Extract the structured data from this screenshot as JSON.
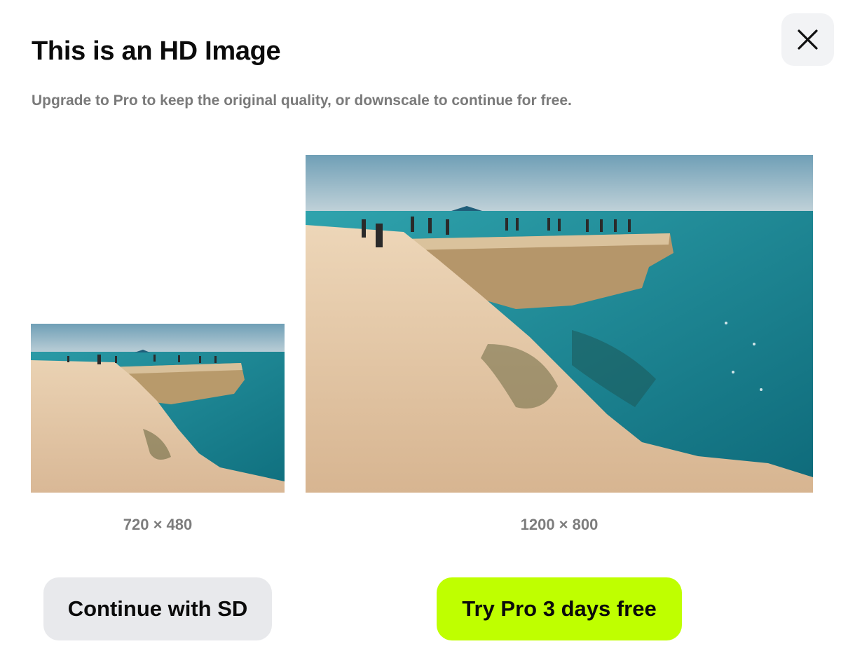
{
  "dialog": {
    "title": "This is an HD Image",
    "subtitle": "Upgrade to Pro to keep the original quality, or downscale to continue for free.",
    "close_icon": "close-icon"
  },
  "previews": {
    "sd": {
      "dimensions": "720 × 480"
    },
    "hd": {
      "dimensions": "1200 × 800"
    }
  },
  "actions": {
    "continue_sd_label": "Continue with SD",
    "try_pro_label": "Try Pro 3 days free"
  },
  "colors": {
    "pro_accent": "#bfff00",
    "secondary_button": "#e8e9ec",
    "close_button_bg": "#f2f3f5",
    "muted_text": "#7a7a7a"
  }
}
